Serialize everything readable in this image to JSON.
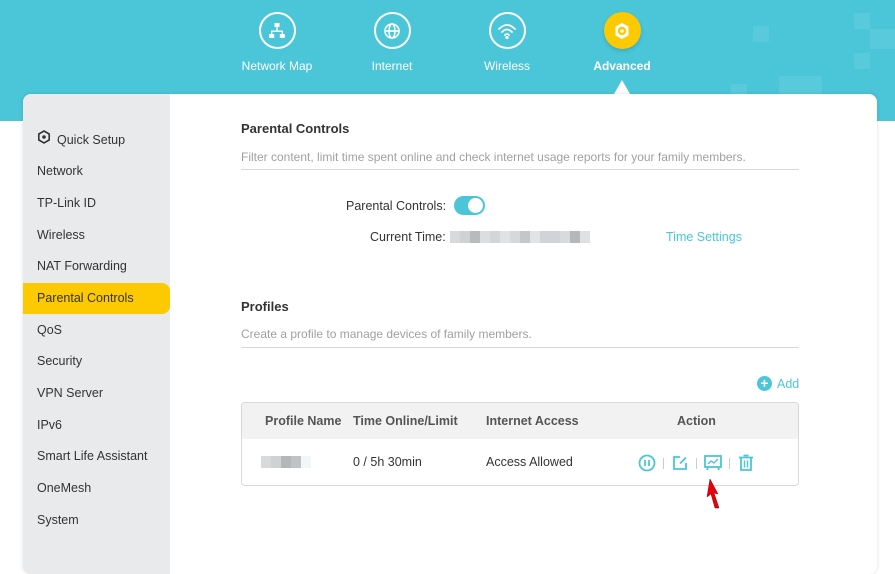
{
  "top_nav": {
    "items": [
      {
        "label": "Network Map",
        "icon": "network-map-icon",
        "active": false
      },
      {
        "label": "Internet",
        "icon": "globe-icon",
        "active": false
      },
      {
        "label": "Wireless",
        "icon": "wifi-icon",
        "active": false
      },
      {
        "label": "Advanced",
        "icon": "gear-icon",
        "active": true
      }
    ]
  },
  "sidebar": {
    "items": [
      {
        "label": "Quick Setup",
        "icon": "gear-icon"
      },
      {
        "label": "Network"
      },
      {
        "label": "TP-Link ID"
      },
      {
        "label": "Wireless"
      },
      {
        "label": "NAT Forwarding"
      },
      {
        "label": "Parental Controls",
        "active": true
      },
      {
        "label": "QoS"
      },
      {
        "label": "Security"
      },
      {
        "label": "VPN Server"
      },
      {
        "label": "IPv6"
      },
      {
        "label": "Smart Life Assistant"
      },
      {
        "label": "OneMesh"
      },
      {
        "label": "System"
      }
    ]
  },
  "parental_controls": {
    "title": "Parental Controls",
    "description": "Filter content, limit time spent online and check internet usage reports for your family members.",
    "toggle_label": "Parental Controls:",
    "toggle_on": true,
    "current_time_label": "Current Time:",
    "time_settings_link": "Time Settings"
  },
  "profiles": {
    "title": "Profiles",
    "description": "Create a profile to manage devices of family members.",
    "add_label": "Add",
    "columns": [
      "Profile Name",
      "Time Online/Limit",
      "Internet Access",
      "Action"
    ],
    "rows": [
      {
        "profile_name": "",
        "time_online_limit": "0 / 5h 30min",
        "internet_access": "Access Allowed",
        "actions": [
          "pause-icon",
          "edit-icon",
          "insights-chart-icon",
          "trash-icon"
        ]
      }
    ]
  },
  "colors": {
    "brand": "#4ac6d8",
    "accent": "#fdc900",
    "cursor": "#e8000b"
  }
}
